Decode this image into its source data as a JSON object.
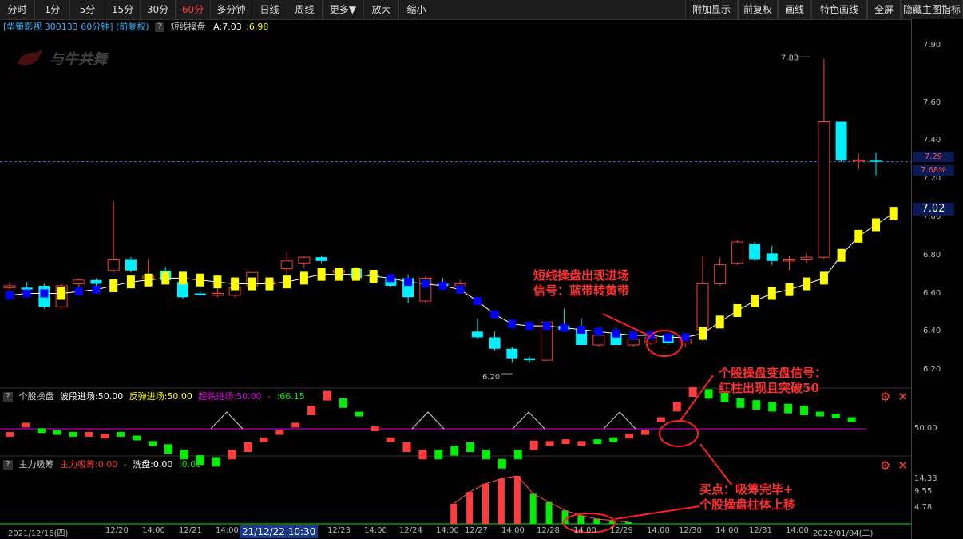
{
  "toolbar": {
    "left": [
      "分时",
      "1分",
      "5分",
      "15分",
      "30分",
      "60分",
      "多分钟",
      "日线",
      "周线",
      "更多▼",
      "放大",
      "缩小"
    ],
    "active": "60分",
    "right": [
      "附加显示",
      "前复权",
      "画线",
      "特色画线",
      "全屏",
      "隐藏主图指标"
    ]
  },
  "main_header": {
    "stock": "[华策影视 300133 60分钟]",
    "adjust": "(前复权)",
    "q": "?",
    "indicator": "短线操盘",
    "a_label": "A:7.03",
    "b_label": ":6.98"
  },
  "watermark": "与牛共舞",
  "price_axis": [
    "7.90",
    "7.60",
    "7.40",
    "7.20",
    "7.00",
    "6.80",
    "6.60",
    "6.40",
    "6.20"
  ],
  "price_tags": {
    "last": "7.29",
    "pct": "7.68%",
    "ind": "7.02"
  },
  "peak_label": "7.83",
  "low_label": "6.20",
  "panel2": {
    "q": "?",
    "title": "个股操盘",
    "p1": "波段进场:50.00",
    "p2": "反弹进场:50.00",
    "p3": "超跌进场:50.00",
    "p4": "-",
    "p5": ":66.15",
    "axis": "50.00"
  },
  "panel3": {
    "q": "?",
    "title": "主力吸筹",
    "p1": "主力吸筹:0.00",
    "p2": "-",
    "p3": "洗盘:0.00",
    "p4": ":0.00",
    "axis": [
      "14.33",
      "9.55",
      "4.78"
    ]
  },
  "icons": {
    "gear": "⚙",
    "close": "✕"
  },
  "time_axis": {
    "start": "2021/12/16(四)",
    "cursor": "21/12/22 10:30",
    "end": "2022/01/04(二)",
    "labels": [
      "12/20",
      "14:00",
      "12/21",
      "14:00",
      "12/23",
      "14:00",
      "12/24",
      "14:00",
      "12/27",
      "14:00",
      "12/28",
      "14:00",
      "12/29",
      "14:00",
      "12/30",
      "14:00",
      "12/31",
      "14:00"
    ]
  },
  "annotations": {
    "a1_line1": "短线操盘出现进场",
    "a1_line2": "信号：蓝带转黄带",
    "a2_line1": "个股操盘变盘信号：",
    "a2_line2": "红柱出现且突破50",
    "a3_line1": "买点：吸筹完毕+",
    "a3_line2": "个股操盘柱体上移"
  },
  "colors": {
    "up": "#ff3b3b",
    "down": "#00f0ff",
    "green": "#00ee00",
    "yellow": "#ffff00",
    "blue": "#0000ff",
    "magenta": "#e000e0"
  },
  "chart_data": {
    "type": "candlestick",
    "ylim": [
      6.15,
      7.95
    ],
    "candles": [
      {
        "o": 6.63,
        "h": 6.66,
        "l": 6.62,
        "c": 6.64
      },
      {
        "o": 6.63,
        "h": 6.66,
        "l": 6.6,
        "c": 6.62
      },
      {
        "o": 6.64,
        "h": 6.65,
        "l": 6.52,
        "c": 6.53
      },
      {
        "o": 6.53,
        "h": 6.65,
        "l": 6.52,
        "c": 6.64
      },
      {
        "o": 6.65,
        "h": 6.68,
        "l": 6.62,
        "c": 6.67
      },
      {
        "o": 6.67,
        "h": 6.68,
        "l": 6.63,
        "c": 6.65
      },
      {
        "o": 6.72,
        "h": 7.08,
        "l": 6.71,
        "c": 6.78
      },
      {
        "o": 6.78,
        "h": 6.79,
        "l": 6.71,
        "c": 6.72
      },
      {
        "o": 6.68,
        "h": 6.78,
        "l": 6.67,
        "c": 6.69
      },
      {
        "o": 6.72,
        "h": 6.74,
        "l": 6.69,
        "c": 6.67
      },
      {
        "o": 6.66,
        "h": 6.67,
        "l": 6.57,
        "c": 6.58
      },
      {
        "o": 6.6,
        "h": 6.62,
        "l": 6.59,
        "c": 6.59
      },
      {
        "o": 6.59,
        "h": 6.63,
        "l": 6.58,
        "c": 6.6
      },
      {
        "o": 6.59,
        "h": 6.66,
        "l": 6.58,
        "c": 6.63
      },
      {
        "o": 6.64,
        "h": 6.7,
        "l": 6.63,
        "c": 6.71
      },
      {
        "o": 6.65,
        "h": 6.68,
        "l": 6.63,
        "c": 6.66
      },
      {
        "o": 6.73,
        "h": 6.82,
        "l": 6.69,
        "c": 6.77
      },
      {
        "o": 6.76,
        "h": 6.8,
        "l": 6.73,
        "c": 6.79
      },
      {
        "o": 6.79,
        "h": 6.8,
        "l": 6.76,
        "c": 6.77
      },
      {
        "o": 6.71,
        "h": 6.74,
        "l": 6.69,
        "c": 6.72
      },
      {
        "o": 6.73,
        "h": 6.74,
        "l": 6.69,
        "c": 6.68
      },
      {
        "o": 6.7,
        "h": 6.72,
        "l": 6.68,
        "c": 6.69
      },
      {
        "o": 6.68,
        "h": 6.69,
        "l": 6.63,
        "c": 6.64
      },
      {
        "o": 6.68,
        "h": 6.7,
        "l": 6.55,
        "c": 6.58
      },
      {
        "o": 6.56,
        "h": 6.69,
        "l": 6.55,
        "c": 6.68
      },
      {
        "o": 6.65,
        "h": 6.68,
        "l": 6.63,
        "c": 6.64
      },
      {
        "o": 6.64,
        "h": 6.67,
        "l": 6.63,
        "c": 6.65
      },
      {
        "o": 6.4,
        "h": 6.47,
        "l": 6.36,
        "c": 6.37
      },
      {
        "o": 6.37,
        "h": 6.4,
        "l": 6.3,
        "c": 6.31
      },
      {
        "o": 6.31,
        "h": 6.32,
        "l": 6.24,
        "c": 6.26
      },
      {
        "o": 6.26,
        "h": 6.27,
        "l": 6.24,
        "c": 6.25
      },
      {
        "o": 6.25,
        "h": 6.45,
        "l": 6.25,
        "c": 6.45
      },
      {
        "o": 6.43,
        "h": 6.52,
        "l": 6.41,
        "c": 6.41
      },
      {
        "o": 6.41,
        "h": 6.47,
        "l": 6.33,
        "c": 6.33
      },
      {
        "o": 6.33,
        "h": 6.38,
        "l": 6.32,
        "c": 6.38
      },
      {
        "o": 6.39,
        "h": 6.42,
        "l": 6.32,
        "c": 6.33
      },
      {
        "o": 6.33,
        "h": 6.39,
        "l": 6.32,
        "c": 6.36
      },
      {
        "o": 6.34,
        "h": 6.38,
        "l": 6.33,
        "c": 6.37
      },
      {
        "o": 6.38,
        "h": 6.39,
        "l": 6.33,
        "c": 6.34
      },
      {
        "o": 6.34,
        "h": 6.38,
        "l": 6.32,
        "c": 6.36
      },
      {
        "o": 6.41,
        "h": 6.8,
        "l": 6.35,
        "c": 6.65
      },
      {
        "o": 6.65,
        "h": 6.79,
        "l": 6.64,
        "c": 6.75
      },
      {
        "o": 6.76,
        "h": 6.88,
        "l": 6.75,
        "c": 6.87
      },
      {
        "o": 6.86,
        "h": 6.87,
        "l": 6.77,
        "c": 6.78
      },
      {
        "o": 6.81,
        "h": 6.85,
        "l": 6.75,
        "c": 6.77
      },
      {
        "o": 6.77,
        "h": 6.8,
        "l": 6.72,
        "c": 6.78
      },
      {
        "o": 6.78,
        "h": 6.81,
        "l": 6.76,
        "c": 6.79
      },
      {
        "o": 6.79,
        "h": 7.83,
        "l": 6.78,
        "c": 7.5
      },
      {
        "o": 7.5,
        "h": 7.5,
        "l": 7.29,
        "c": 7.3
      },
      {
        "o": 7.3,
        "h": 7.33,
        "l": 7.25,
        "c": 7.3
      },
      {
        "o": 7.3,
        "h": 7.34,
        "l": 7.22,
        "c": 7.29
      }
    ],
    "indicator_line": [
      6.59,
      6.6,
      6.6,
      6.6,
      6.61,
      6.62,
      6.64,
      6.66,
      6.67,
      6.68,
      6.68,
      6.67,
      6.66,
      6.65,
      6.65,
      6.65,
      6.66,
      6.68,
      6.7,
      6.7,
      6.7,
      6.69,
      6.68,
      6.66,
      6.65,
      6.64,
      6.62,
      6.56,
      6.49,
      6.44,
      6.43,
      6.43,
      6.42,
      6.41,
      6.4,
      6.39,
      6.38,
      6.38,
      6.37,
      6.37,
      6.39,
      6.45,
      6.51,
      6.56,
      6.6,
      6.62,
      6.65,
      6.68,
      6.8,
      6.9,
      6.96,
      7.02
    ],
    "band_colors": [
      "b",
      "b",
      "b",
      "y",
      "b",
      "b",
      "y",
      "y",
      "y",
      "y",
      "y",
      "y",
      "y",
      "y",
      "y",
      "y",
      "y",
      "y",
      "y",
      "y",
      "y",
      "y",
      "b",
      "b",
      "b",
      "b",
      "b",
      "b",
      "b",
      "b",
      "b",
      "b",
      "b",
      "b",
      "b",
      "b",
      "b",
      "b",
      "b",
      "b",
      "y",
      "y",
      "y",
      "y",
      "y",
      "y",
      "y",
      "y",
      "y",
      "y",
      "y",
      "y"
    ],
    "panel2_values": [
      47,
      52,
      49,
      48,
      47,
      47,
      46,
      47,
      45,
      42,
      39,
      36,
      33,
      32,
      36,
      40,
      44,
      48,
      52,
      60,
      68,
      64,
      58,
      50,
      44,
      40,
      36,
      36,
      38,
      40,
      36,
      31,
      36,
      41,
      42,
      43,
      42,
      43,
      44,
      46,
      48,
      55,
      62,
      70,
      69,
      67,
      64,
      63,
      62,
      61,
      60,
      58,
      57,
      55
    ],
    "panel2_red": [
      1,
      1,
      0,
      0,
      0,
      1,
      1,
      0,
      0,
      0,
      0,
      0,
      0,
      0,
      1,
      1,
      1,
      1,
      1,
      1,
      1,
      0,
      0,
      1,
      1,
      1,
      1,
      0,
      0,
      0,
      0,
      0,
      0,
      1,
      1,
      1,
      1,
      0,
      0,
      1,
      1,
      1,
      1,
      1,
      0,
      0,
      0,
      0,
      0,
      0,
      0,
      0,
      0,
      0
    ],
    "panel3_values": [
      0,
      0,
      0,
      0,
      0,
      0,
      0,
      0,
      0,
      0,
      0,
      0,
      0,
      0,
      0,
      0,
      0,
      0,
      0,
      0,
      0,
      0,
      0,
      0,
      0,
      0,
      0,
      0,
      0,
      0,
      0,
      0,
      0,
      0,
      0,
      0,
      0,
      0,
      6.0,
      9.5,
      12.0,
      13.5,
      14.33,
      9.0,
      6.5,
      4.0,
      2.5,
      1.5,
      1.0,
      0.5,
      0,
      0,
      0,
      0
    ]
  }
}
